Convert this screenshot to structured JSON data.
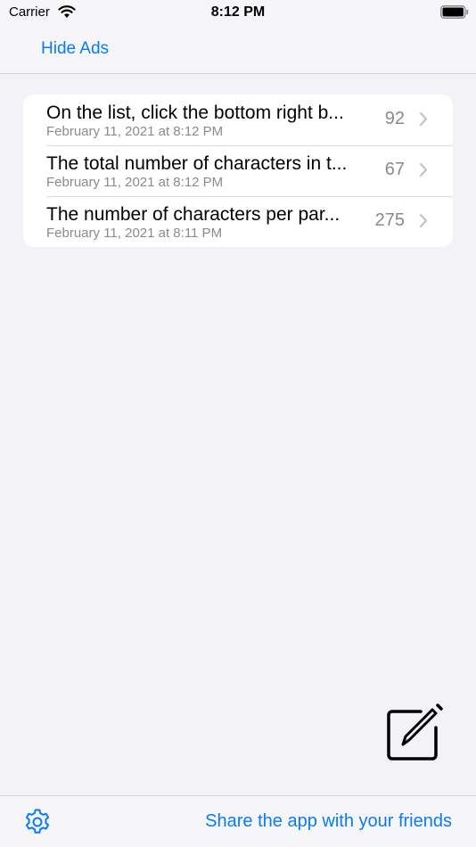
{
  "status_bar": {
    "carrier": "Carrier",
    "time": "8:12 PM"
  },
  "nav": {
    "hide_ads_label": "Hide Ads"
  },
  "notes": [
    {
      "title": "On the list, click the bottom right b...",
      "date": "February 11, 2021 at 8:12 PM",
      "count": "92"
    },
    {
      "title": "The total number of characters in t...",
      "date": "February 11, 2021 at 8:12 PM",
      "count": "67"
    },
    {
      "title": "The number of characters per par...",
      "date": "February 11, 2021 at 8:11 PM",
      "count": "275"
    }
  ],
  "toolbar": {
    "share_label": "Share the app with your friends"
  },
  "icons": {
    "compose": "compose-icon",
    "settings": "gear-icon",
    "row_disclosure": "chevron-right-icon"
  },
  "colors": {
    "accent": "#0a7bf4",
    "secondary_text": "#8a8a8e",
    "background": "#f2f2f7"
  }
}
